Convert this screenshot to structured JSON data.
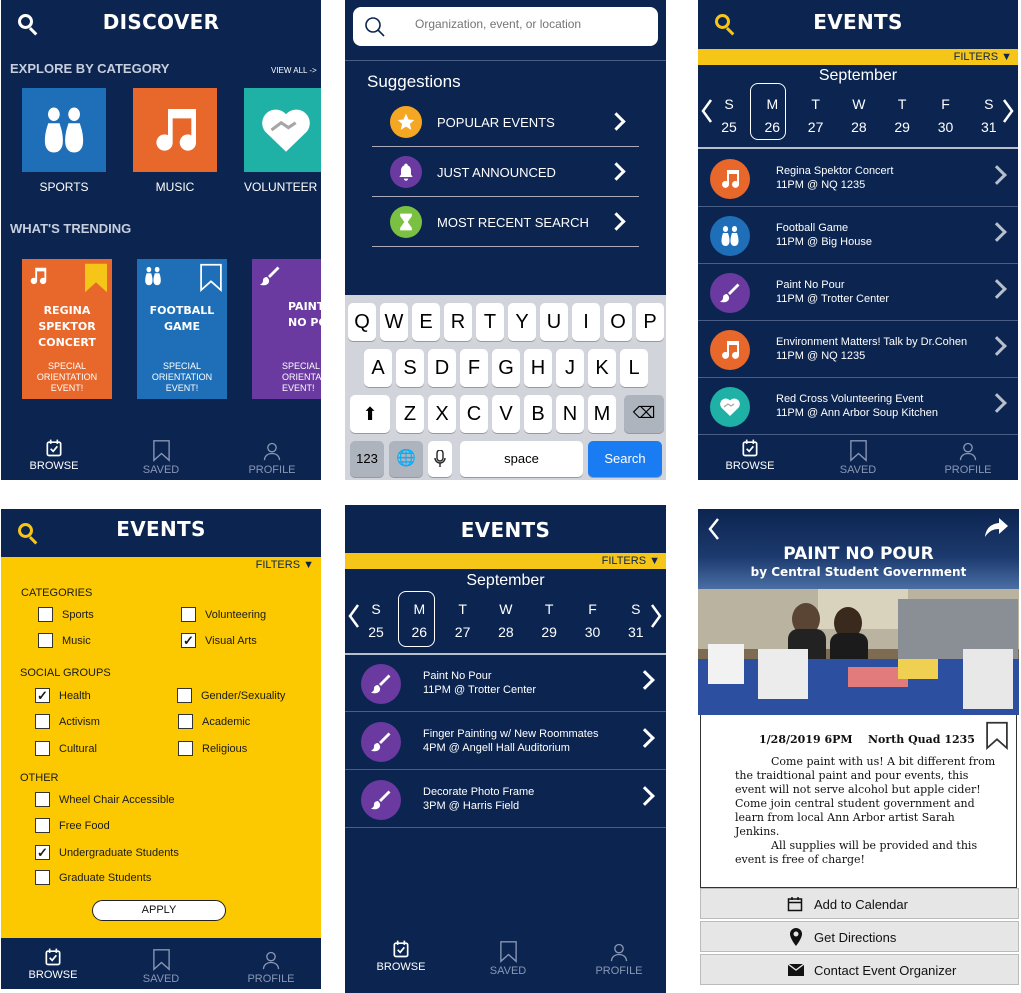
{
  "discover": {
    "title": "DISCOVER",
    "explore_label": "EXPLORE BY CATEGORY",
    "view_all": "VIEW ALL ->",
    "categories": [
      {
        "label": "SPORTS",
        "color": "#1e6fb8",
        "icon": "bowling-icon"
      },
      {
        "label": "MUSIC",
        "color": "#e8672a",
        "icon": "music-note-icon"
      },
      {
        "label": "VOLUNTEER",
        "color": "#1fb0a6",
        "icon": "heart-hands-icon"
      }
    ],
    "trending_label": "WHAT'S TRENDING",
    "trending": [
      {
        "title1": "REGINA SPEKTOR",
        "title2": "CONCERT",
        "sub1": "SPECIAL",
        "sub2": "ORIENTATION",
        "sub3": "EVENT!",
        "color": "#e8672a",
        "bookmark_color": "#f5c518"
      },
      {
        "title1": "FOOTBALL",
        "title2": "GAME",
        "sub1": "SPECIAL",
        "sub2": "ORIENTATION",
        "sub3": "EVENT!",
        "color": "#1e6fb8",
        "bookmark_color": "#ffffff"
      },
      {
        "title1": "PAINT",
        "title2": "NO POU",
        "sub1": "SPECIAL",
        "sub2": "ORIENTATI",
        "sub3": "EVENT!",
        "color": "#6a3aa0",
        "bookmark_color": "#ffffff"
      }
    ]
  },
  "nav": {
    "browse": "BROWSE",
    "saved": "SAVED",
    "profile": "PROFILE"
  },
  "search": {
    "placeholder": "Organization, event, or location",
    "suggestions_label": "Suggestions",
    "suggestions": [
      {
        "label": "POPULAR EVENTS",
        "color": "#f5a623",
        "icon": "star-icon"
      },
      {
        "label": "JUST ANNOUNCED",
        "color": "#6a3aa0",
        "icon": "bell-icon"
      },
      {
        "label": "MOST RECENT SEARCH",
        "color": "#7ac143",
        "icon": "hourglass-icon"
      }
    ],
    "keyboard": {
      "row1": [
        "Q",
        "W",
        "E",
        "R",
        "T",
        "Y",
        "U",
        "I",
        "O",
        "P"
      ],
      "row2": [
        "A",
        "S",
        "D",
        "F",
        "G",
        "H",
        "J",
        "K",
        "L"
      ],
      "row3": [
        "Z",
        "X",
        "C",
        "V",
        "B",
        "N",
        "M"
      ],
      "num_key": "123",
      "space_key": "space",
      "search_key": "Search"
    }
  },
  "events": {
    "title": "EVENTS",
    "filters": "FILTERS ▼",
    "month": "September",
    "days": [
      "S",
      "M",
      "T",
      "W",
      "T",
      "F",
      "S"
    ],
    "dates": [
      "25",
      "26",
      "27",
      "28",
      "29",
      "30",
      "31"
    ],
    "list": [
      {
        "name": "Regina Spektor Concert",
        "time": "11PM @ NQ 1235",
        "color": "#e8672a",
        "icon": "music-note-icon"
      },
      {
        "name": "Football Game",
        "time": "11PM @ Big House",
        "color": "#1e6fb8",
        "icon": "bowling-icon"
      },
      {
        "name": "Paint No Pour",
        "time": "11PM @ Trotter Center",
        "color": "#6a3aa0",
        "icon": "paintbrush-icon"
      },
      {
        "name": "Environment Matters! Talk by Dr.Cohen",
        "time": "11PM @ NQ 1235",
        "color": "#e8672a",
        "icon": "music-note-icon"
      },
      {
        "name": "Red Cross Volunteering Event",
        "time": "11PM @ Ann Arbor Soup Kitchen",
        "color": "#1fb0a6",
        "icon": "heart-hands-icon"
      }
    ]
  },
  "filters": {
    "title": "EVENTS",
    "filters": "FILTERS ▼",
    "categories_label": "CATEGORIES",
    "categories": [
      {
        "label": "Sports",
        "checked": false
      },
      {
        "label": "Volunteering",
        "checked": false
      },
      {
        "label": "Music",
        "checked": false
      },
      {
        "label": "Visual Arts",
        "checked": true
      }
    ],
    "social_label": "SOCIAL GROUPS",
    "social": [
      {
        "label": "Health",
        "checked": true
      },
      {
        "label": "Gender/Sexuality",
        "checked": false
      },
      {
        "label": "Activism",
        "checked": false
      },
      {
        "label": "Academic",
        "checked": false
      },
      {
        "label": "Cultural",
        "checked": false
      },
      {
        "label": "Religious",
        "checked": false
      }
    ],
    "other_label": "OTHER",
    "other": [
      {
        "label": "Wheel Chair Accessible",
        "checked": false
      },
      {
        "label": "Free Food",
        "checked": false
      },
      {
        "label": "Undergraduate Students",
        "checked": true
      },
      {
        "label": "Graduate Students",
        "checked": false
      }
    ],
    "apply": "APPLY"
  },
  "visual_arts": {
    "title": "EVENTS",
    "filters": "FILTERS ▼",
    "month": "September",
    "list": [
      {
        "name": "Paint No Pour",
        "time": "11PM @ Trotter Center"
      },
      {
        "name": "Finger Painting w/ New Roommates",
        "time": "4PM @ Angell Hall Auditorium"
      },
      {
        "name": "Decorate Photo Frame",
        "time": "3PM @ Harris Field"
      }
    ]
  },
  "detail": {
    "title": "PAINT NO POUR",
    "subtitle": "by Central Student Government",
    "date": "1/28/2019 6PM",
    "location": "North Quad 1235",
    "desc1": "Come paint with us! A bit different from the traidtional paint and pour events, this event will not serve alcohol but apple cider! Come join central student government and learn from local Ann Arbor artist Sarah Jenkins.",
    "desc2": "All supplies will be provided and this event is free of charge!",
    "actions": [
      {
        "label": "Add to Calendar",
        "icon": "calendar-icon"
      },
      {
        "label": "Get Directions",
        "icon": "map-pin-icon"
      },
      {
        "label": "Contact Event Organizer",
        "icon": "envelope-icon"
      }
    ]
  }
}
